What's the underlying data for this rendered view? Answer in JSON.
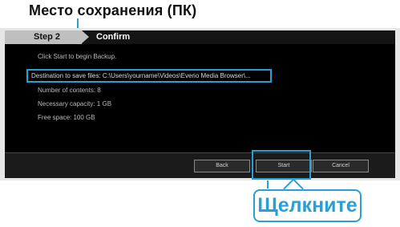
{
  "annotation": {
    "save_location": "Место сохранения (ПК)",
    "click": "Щелкните",
    "accent_color": "#2a9fd6"
  },
  "dialog": {
    "step_label": "Step 2",
    "confirm_label": "Confirm",
    "header_text": "Click Start to begin Backup.",
    "destination_text": "Destination to save files: C:\\Users\\yourname\\Videos\\Everio Media Browser\\...",
    "info_lines": [
      "Number of contents: 8",
      "Necessary capacity: 1 GB",
      "Free space: 100 GB"
    ],
    "buttons": {
      "back": "Back",
      "start": "Start",
      "cancel": "Cancel"
    }
  }
}
